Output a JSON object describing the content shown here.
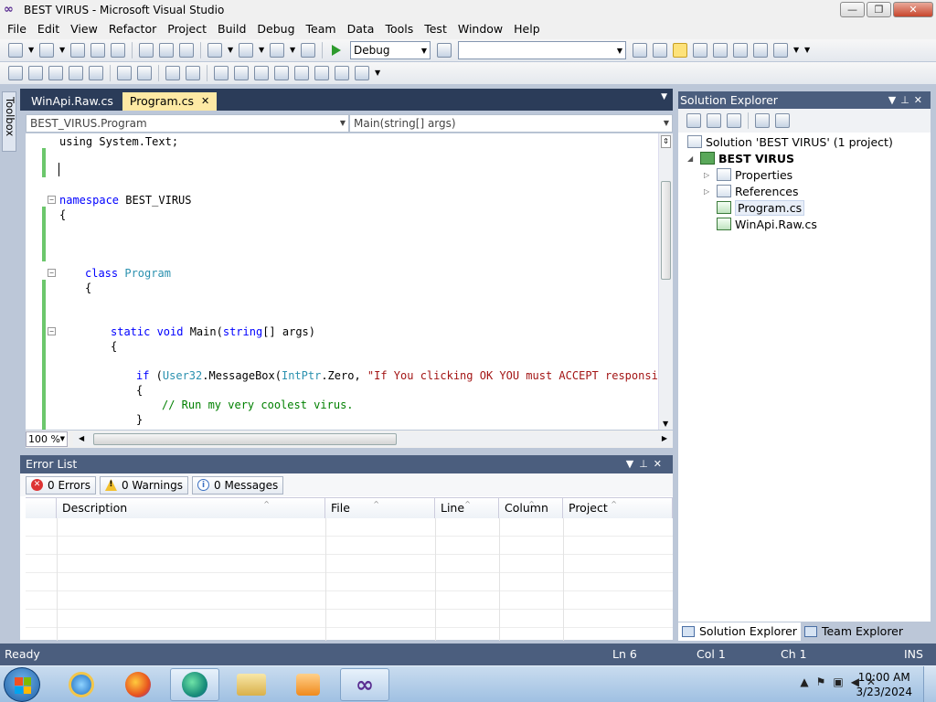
{
  "window": {
    "title": "BEST VIRUS - Microsoft Visual Studio",
    "minimize": "—",
    "maximize": "❐",
    "close": "✕"
  },
  "menu": [
    "File",
    "Edit",
    "View",
    "Refactor",
    "Project",
    "Build",
    "Debug",
    "Team",
    "Data",
    "Tools",
    "Test",
    "Window",
    "Help"
  ],
  "toolbar": {
    "configuration": "Debug",
    "platform": ""
  },
  "toolbox": {
    "label": "Toolbox"
  },
  "doc_tabs": [
    {
      "label": "WinApi.Raw.cs"
    },
    {
      "label": "Program.cs",
      "close": "✕"
    }
  ],
  "nav": {
    "type": "BEST_VIRUS.Program",
    "member": "Main(string[] args)"
  },
  "code": {
    "l1": "using System.Text;",
    "l3a": "namespace",
    "l3b": " BEST_VIRUS",
    "l4": "{",
    "l5a": "class",
    "l5b": "Program",
    "l6": "{",
    "l7a": "static void",
    "l7b": " Main(",
    "l7c": "string",
    "l7d": "[] args)",
    "l8": "{",
    "l9a": "if",
    "l9b": " (",
    "l9c": "User32",
    "l9d": ".MessageBox(",
    "l9e": "IntPtr",
    "l9f": ".Zero, ",
    "l9g": "\"If You clicking OK YOU must ACCEPT responsibli",
    "l10": "{",
    "l11": "// Run my very coolest virus.",
    "l12": "}"
  },
  "editor": {
    "zoom": "100 %"
  },
  "error_list": {
    "title": "Error List",
    "filters": {
      "errors": "0 Errors",
      "warnings": "0 Warnings",
      "messages": "0 Messages"
    },
    "columns": [
      "Description",
      "File",
      "Line",
      "Column",
      "Project"
    ]
  },
  "solution_explorer": {
    "title": "Solution Explorer",
    "solution": "Solution 'BEST VIRUS' (1 project)",
    "project": "BEST VIRUS",
    "items": [
      "Properties",
      "References",
      "Program.cs",
      "WinApi.Raw.cs"
    ],
    "tabs": [
      "Solution Explorer",
      "Team Explorer"
    ]
  },
  "status": {
    "state": "Ready",
    "ln": "Ln 6",
    "col": "Col 1",
    "ch": "Ch 1",
    "mode": "INS"
  },
  "taskbar": {
    "time": "10:00 AM",
    "date": "3/23/2024"
  },
  "colors": {
    "accent": "#4b5e7e",
    "active_tab": "#fee9a4",
    "keyword": "#0000ff",
    "type": "#2b91af",
    "string": "#a31515",
    "comment": "#008000"
  }
}
